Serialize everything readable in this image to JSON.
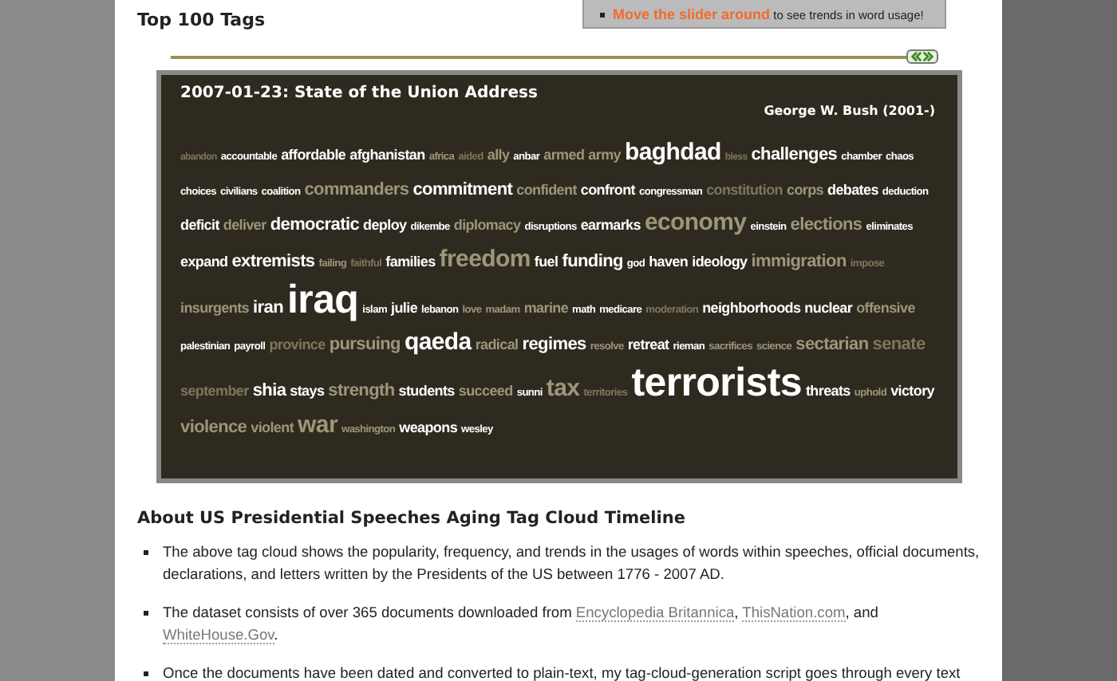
{
  "heading": "Top 100 Tags",
  "tip": {
    "link": "Move the slider around",
    "text": " to see trends in word usage!"
  },
  "slider": {
    "level": 1
  },
  "cloud": {
    "title": "2007-01-23: State of the Union Address",
    "president": "George W. Bush (2001-)",
    "tags": [
      {
        "text": "abandon",
        "kind": "xs",
        "color": "#7d775d"
      },
      {
        "text": "accountable",
        "kind": "s",
        "color": "#ffffff"
      },
      {
        "text": "affordable",
        "kind": "m",
        "color": "#ffffff"
      },
      {
        "text": "afghanistan",
        "kind": "m",
        "color": "#ffffff"
      },
      {
        "text": "africa",
        "kind": "s",
        "color": "#9c967a"
      },
      {
        "text": "aided",
        "kind": "s",
        "color": "#7d775d"
      },
      {
        "text": "ally",
        "kind": "m",
        "color": "#9c967a"
      },
      {
        "text": "anbar",
        "kind": "s",
        "color": "#ffffff"
      },
      {
        "text": "armed",
        "kind": "m",
        "color": "#9c967a"
      },
      {
        "text": "army",
        "kind": "m",
        "color": "#9c967a"
      },
      {
        "text": "baghdad",
        "kind": "xl",
        "color": "#ffffff"
      },
      {
        "text": "bless",
        "kind": "xs",
        "color": "#7d775d"
      },
      {
        "text": "challenges",
        "kind": "l",
        "color": "#ffffff"
      },
      {
        "text": "chamber",
        "kind": "s",
        "color": "#ffffff"
      },
      {
        "text": "chaos",
        "kind": "s",
        "color": "#ffffff"
      },
      {
        "text": "choices",
        "kind": "s",
        "color": "#ffffff"
      },
      {
        "text": "civilians",
        "kind": "s",
        "color": "#ffffff"
      },
      {
        "text": "coalition",
        "kind": "s",
        "color": "#ffffff"
      },
      {
        "text": "commanders",
        "kind": "l",
        "color": "#9c967a"
      },
      {
        "text": "commitment",
        "kind": "l",
        "color": "#ffffff"
      },
      {
        "text": "confident",
        "kind": "m",
        "color": "#9c967a"
      },
      {
        "text": "confront",
        "kind": "m",
        "color": "#ffffff"
      },
      {
        "text": "congressman",
        "kind": "s",
        "color": "#ffffff"
      },
      {
        "text": "constitution",
        "kind": "m",
        "color": "#7d775d"
      },
      {
        "text": "corps",
        "kind": "m",
        "color": "#9c967a"
      },
      {
        "text": "debates",
        "kind": "m",
        "color": "#ffffff"
      },
      {
        "text": "deduction",
        "kind": "s",
        "color": "#ffffff"
      },
      {
        "text": "deficit",
        "kind": "m",
        "color": "#ffffff"
      },
      {
        "text": "deliver",
        "kind": "m",
        "color": "#9c967a"
      },
      {
        "text": "democratic",
        "kind": "l",
        "color": "#ffffff"
      },
      {
        "text": "deploy",
        "kind": "m",
        "color": "#ffffff"
      },
      {
        "text": "dikembe",
        "kind": "s",
        "color": "#ffffff"
      },
      {
        "text": "diplomacy",
        "kind": "m",
        "color": "#9c967a"
      },
      {
        "text": "disruptions",
        "kind": "s",
        "color": "#ffffff"
      },
      {
        "text": "earmarks",
        "kind": "m",
        "color": "#ffffff"
      },
      {
        "text": "economy",
        "kind": "xl",
        "color": "#9c967a"
      },
      {
        "text": "einstein",
        "kind": "s",
        "color": "#ffffff"
      },
      {
        "text": "elections",
        "kind": "l",
        "color": "#9c967a"
      },
      {
        "text": "eliminates",
        "kind": "s",
        "color": "#ffffff"
      },
      {
        "text": "expand",
        "kind": "m",
        "color": "#ffffff"
      },
      {
        "text": "extremists",
        "kind": "l",
        "color": "#ffffff"
      },
      {
        "text": "failing",
        "kind": "s",
        "color": "#9c967a"
      },
      {
        "text": "faithful",
        "kind": "s",
        "color": "#7d775d"
      },
      {
        "text": "families",
        "kind": "m",
        "color": "#ffffff"
      },
      {
        "text": "freedom",
        "kind": "xl",
        "color": "#9c967a"
      },
      {
        "text": "fuel",
        "kind": "m",
        "color": "#ffffff"
      },
      {
        "text": "funding",
        "kind": "l",
        "color": "#ffffff"
      },
      {
        "text": "god",
        "kind": "s",
        "color": "#ffffff"
      },
      {
        "text": "haven",
        "kind": "m",
        "color": "#ffffff"
      },
      {
        "text": "ideology",
        "kind": "m",
        "color": "#ffffff"
      },
      {
        "text": "immigration",
        "kind": "l",
        "color": "#9c967a"
      },
      {
        "text": "impose",
        "kind": "s",
        "color": "#7d775d"
      },
      {
        "text": "insurgents",
        "kind": "m",
        "color": "#9c967a"
      },
      {
        "text": "iran",
        "kind": "l",
        "color": "#ffffff"
      },
      {
        "text": "iraq",
        "kind": "xxl",
        "color": "#ffffff"
      },
      {
        "text": "islam",
        "kind": "s",
        "color": "#ffffff"
      },
      {
        "text": "julie",
        "kind": "m",
        "color": "#ffffff"
      },
      {
        "text": "lebanon",
        "kind": "s",
        "color": "#ffffff"
      },
      {
        "text": "love",
        "kind": "s",
        "color": "#9c967a"
      },
      {
        "text": "madam",
        "kind": "s",
        "color": "#9c967a"
      },
      {
        "text": "marine",
        "kind": "m",
        "color": "#9c967a"
      },
      {
        "text": "math",
        "kind": "s",
        "color": "#ffffff"
      },
      {
        "text": "medicare",
        "kind": "s",
        "color": "#ffffff"
      },
      {
        "text": "moderation",
        "kind": "s",
        "color": "#7d775d"
      },
      {
        "text": "neighborhoods",
        "kind": "m",
        "color": "#ffffff"
      },
      {
        "text": "nuclear",
        "kind": "m",
        "color": "#ffffff"
      },
      {
        "text": "offensive",
        "kind": "m",
        "color": "#9c967a"
      },
      {
        "text": "palestinian",
        "kind": "s",
        "color": "#ffffff"
      },
      {
        "text": "payroll",
        "kind": "s",
        "color": "#ffffff"
      },
      {
        "text": "province",
        "kind": "m",
        "color": "#7d775d"
      },
      {
        "text": "pursuing",
        "kind": "l",
        "color": "#9c967a"
      },
      {
        "text": "qaeda",
        "kind": "xl",
        "color": "#ffffff"
      },
      {
        "text": "radical",
        "kind": "m",
        "color": "#9c967a"
      },
      {
        "text": "regimes",
        "kind": "l",
        "color": "#ffffff"
      },
      {
        "text": "resolve",
        "kind": "s",
        "color": "#9c967a"
      },
      {
        "text": "retreat",
        "kind": "m",
        "color": "#ffffff"
      },
      {
        "text": "rieman",
        "kind": "s",
        "color": "#ffffff"
      },
      {
        "text": "sacrifices",
        "kind": "s",
        "color": "#9c967a"
      },
      {
        "text": "science",
        "kind": "s",
        "color": "#9c967a"
      },
      {
        "text": "sectarian",
        "kind": "l",
        "color": "#9c967a"
      },
      {
        "text": "senate",
        "kind": "l",
        "color": "#7d775d"
      },
      {
        "text": "september",
        "kind": "m",
        "color": "#7d775d"
      },
      {
        "text": "shia",
        "kind": "l",
        "color": "#ffffff"
      },
      {
        "text": "stays",
        "kind": "m",
        "color": "#ffffff"
      },
      {
        "text": "strength",
        "kind": "l",
        "color": "#9c967a"
      },
      {
        "text": "students",
        "kind": "m",
        "color": "#ffffff"
      },
      {
        "text": "succeed",
        "kind": "m",
        "color": "#9c967a"
      },
      {
        "text": "sunni",
        "kind": "s",
        "color": "#ffffff"
      },
      {
        "text": "tax",
        "kind": "xl",
        "color": "#9c967a"
      },
      {
        "text": "territories",
        "kind": "s",
        "color": "#7d775d"
      },
      {
        "text": "terrorists",
        "kind": "xxl",
        "color": "#ffffff"
      },
      {
        "text": "threats",
        "kind": "m",
        "color": "#ffffff"
      },
      {
        "text": "uphold",
        "kind": "s",
        "color": "#9c967a"
      },
      {
        "text": "victory",
        "kind": "m",
        "color": "#ffffff"
      },
      {
        "text": "violence",
        "kind": "l",
        "color": "#9c967a"
      },
      {
        "text": "violent",
        "kind": "m",
        "color": "#9c967a"
      },
      {
        "text": "war",
        "kind": "xl",
        "color": "#9c967a"
      },
      {
        "text": "washington",
        "kind": "s",
        "color": "#9c967a"
      },
      {
        "text": "weapons",
        "kind": "m",
        "color": "#ffffff"
      },
      {
        "text": "wesley",
        "kind": "s",
        "color": "#ffffff"
      }
    ]
  },
  "about": {
    "title": "About US Presidential Speeches Aging Tag Cloud Timeline",
    "bullets": [
      [
        {
          "text": "The above tag cloud shows the popularity, frequency, and trends in the usages of words within speeches, official documents, declarations, and letters written by the Presidents of the US between 1776 - 2007 AD."
        }
      ],
      [
        {
          "text": "The dataset consists of over 365 documents downloaded from "
        },
        {
          "link": "Encyclopedia Britannica"
        },
        {
          "text": ", "
        },
        {
          "link": "ThisNation.com"
        },
        {
          "text": ", and "
        },
        {
          "link": "WhiteHouse.Gov"
        },
        {
          "text": "."
        }
      ],
      [
        {
          "text": "Once the documents have been dated and converted to plain-text, my tag-cloud-generation script goes through every text"
        }
      ]
    ]
  }
}
